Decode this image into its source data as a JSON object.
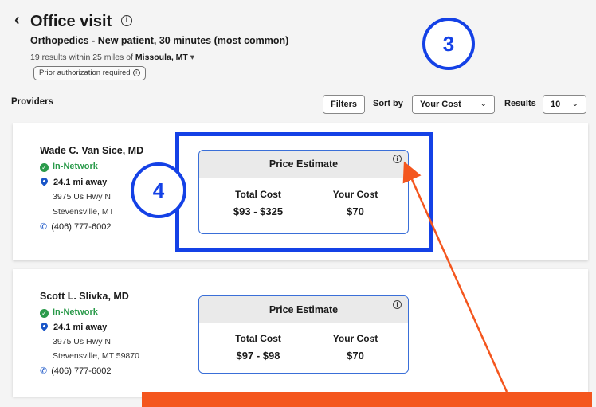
{
  "header": {
    "back_glyph": "‹",
    "title": "Office visit",
    "title_info_glyph": "i",
    "subtitle": "Orthopedics - New patient, 30 minutes (most common)",
    "results_prefix": "19 results within 25 miles of",
    "location": "Missoula, MT",
    "location_caret": "▾",
    "prior_auth": "Prior authorization required"
  },
  "toolbar": {
    "providers_label": "Providers",
    "filters_label": "Filters",
    "sort_label": "Sort by",
    "sort_value": "Your Cost",
    "results_label": "Results",
    "results_value": "10",
    "chevron": "⌄"
  },
  "providers": [
    {
      "name": "Wade C. Van Sice, MD",
      "network": "In-Network",
      "distance": "24.1 mi away",
      "address_line1": "3975 Us Hwy N",
      "address_line2": "Stevensville, MT",
      "phone": "(406) 777-6002",
      "price_title": "Price Estimate",
      "total_cost_label": "Total Cost",
      "total_cost": "$93 - $325",
      "your_cost_label": "Your Cost",
      "your_cost": "$70"
    },
    {
      "name": "Scott L. Slivka, MD",
      "network": "In-Network",
      "distance": "24.1 mi away",
      "address_line1": "3975 Us Hwy N",
      "address_line2": "Stevensville, MT 59870",
      "phone": "(406) 777-6002",
      "price_title": "Price Estimate",
      "total_cost_label": "Total Cost",
      "total_cost": "$97 - $98",
      "your_cost_label": "Your Cost",
      "your_cost": "$70"
    }
  ],
  "annotations": {
    "badge_3": "3",
    "badge_4": "4",
    "box_color": "#1441e6",
    "arrow_color": "#f4561e"
  },
  "icons": {
    "check": "✓",
    "phone": "✆",
    "info": "i"
  }
}
